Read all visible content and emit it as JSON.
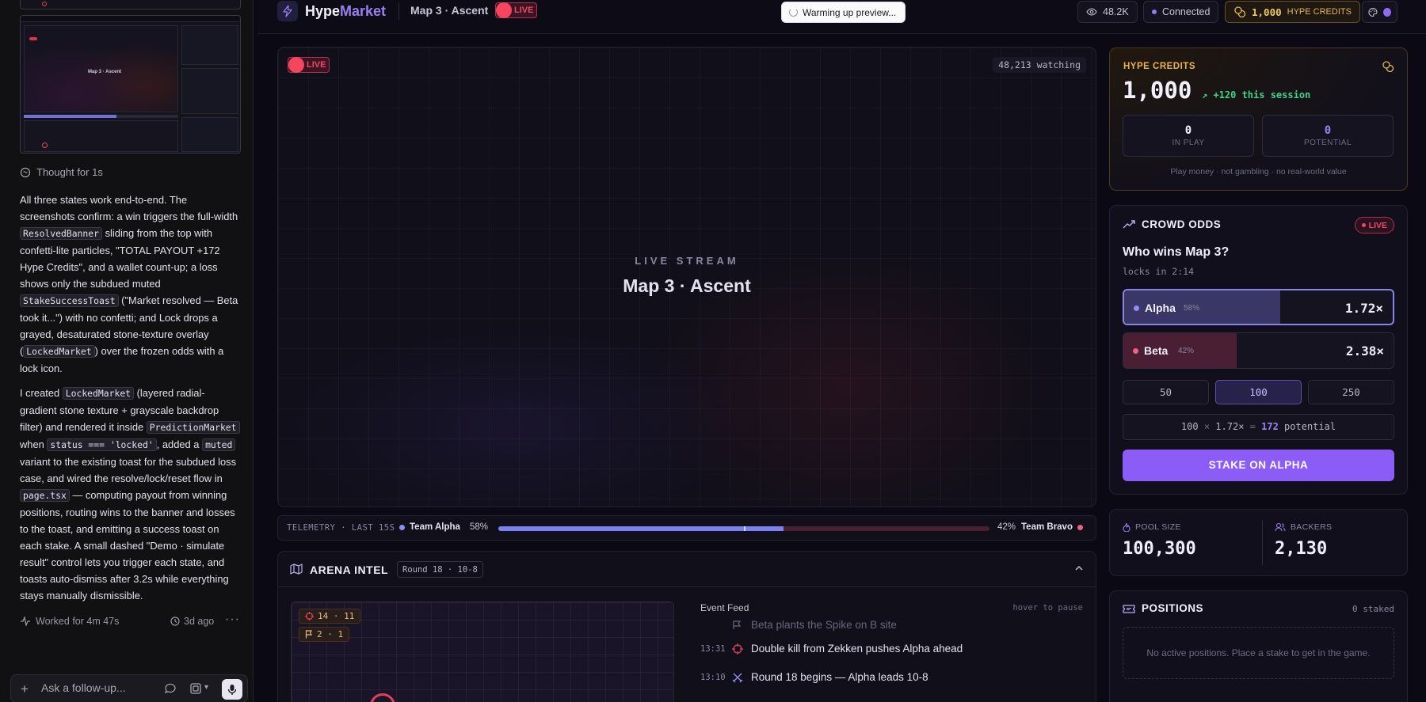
{
  "chat": {
    "thought": "Thought for 1s",
    "thumbnail": {
      "brand": "HypeMarket",
      "stream_title": "Map 3 · Ascent"
    },
    "paragraph1": {
      "t1": "All three states work end-to-end. The screenshots confirm: a win triggers the full-width ",
      "c1": "ResolvedBanner",
      "t2": " sliding from the top with confetti-lite particles, \"TOTAL PAYOUT +172 Hype Credits\", and a wallet count-up; a loss shows only the subdued muted ",
      "c2": "StakeSuccessToast",
      "t3": " (\"Market resolved — Beta took it...\") with no confetti; and Lock drops a grayed, desaturated stone-texture overlay (",
      "c3": "LockedMarket",
      "t4": ") over the frozen odds with a lock icon."
    },
    "paragraph2": {
      "t1": "I created ",
      "c1": "LockedMarket",
      "t2": " (layered radial-gradient stone texture + grayscale backdrop filter) and rendered it inside ",
      "c2": "PredictionMarket",
      "t3": " when ",
      "c3": "status === 'locked'",
      "t4": ", added a ",
      "c4": "muted",
      "t5": " variant to the existing toast for the subdued loss case, and wired the resolve/lock/reset flow in ",
      "c5": "page.tsx",
      "t6": " — computing payout from winning positions, routing wins to the banner and losses to the toast, and emitting a success toast on each stake. A small dashed \"Demo · simulate result\" control lets you trigger each state, and toasts auto-dismiss after 3.2s while everything stays manually dismissible."
    },
    "worked": "Worked for 4m 47s",
    "ago": "3d ago",
    "followup_placeholder": "Ask a follow-up..."
  },
  "nav": {
    "brand_a": "Hype",
    "brand_b": "Market",
    "map": "Map 3 · Ascent",
    "live": "LIVE",
    "toast": "Warming up preview...",
    "viewers": "48.2K",
    "connection": "Connected",
    "credits_value": "1,000",
    "credits_label": "HYPE CREDITS"
  },
  "stream": {
    "live": "LIVE",
    "watching": "48,213 watching",
    "kicker": "LIVE STREAM",
    "title": "Map 3 · Ascent"
  },
  "telemetry": {
    "label": "TELEMETRY · LAST 15S",
    "team_a": "Team Alpha",
    "team_a_pct": "58%",
    "team_b_pct": "42%",
    "team_b": "Team Bravo",
    "alpha_share": 0.58
  },
  "arena": {
    "title": "ARENA INTEL",
    "round": "Round 18 · 10-8",
    "kills": "14 · 11",
    "plants": "2 · 1",
    "feed_title": "Event Feed",
    "feed_hint": "hover to pause",
    "feed": [
      {
        "ts": "",
        "text": "Beta plants the Spike on B site"
      },
      {
        "ts": "13:31",
        "text": "Double kill from Zekken pushes Alpha ahead"
      },
      {
        "ts": "13:10",
        "text": "Round 18 begins — Alpha leads 10-8"
      }
    ]
  },
  "credits_card": {
    "label": "HYPE CREDITS",
    "value": "1,000",
    "delta": "+120 this session",
    "in_play_value": "0",
    "in_play_label": "IN PLAY",
    "potential_value": "0",
    "potential_label": "POTENTIAL",
    "footer": "Play money · not gambling · no real-world value"
  },
  "odds": {
    "title": "CROWD ODDS",
    "live": "LIVE",
    "question": "Who wins Map 3?",
    "locks": "locks in 2:14",
    "teams": [
      {
        "name": "Alpha",
        "pct": "58%",
        "share": 0.58,
        "odds": "1.72×"
      },
      {
        "name": "Beta",
        "pct": "42%",
        "share": 0.42,
        "odds": "2.38×"
      }
    ],
    "amounts": [
      "50",
      "100",
      "250"
    ],
    "selected_amount": "100",
    "calc_stake": "100",
    "calc_x": "×",
    "calc_mult": "1.72×",
    "calc_eq": "=",
    "calc_result": "172",
    "calc_suffix": "potential",
    "stake_button": "STAKE ON ALPHA"
  },
  "pool": {
    "pool_label": "POOL SIZE",
    "pool_value": "100,300",
    "backers_label": "BACKERS",
    "backers_value": "2,130"
  },
  "positions": {
    "title": "POSITIONS",
    "count": "0 staked",
    "empty": "No active positions. Place a stake to get in the game."
  },
  "colors": {
    "accent": "#8b5cf6",
    "live": "#f4465f",
    "alpha": "#8a8ff0",
    "beta": "#f0608a",
    "credits": "#e8b548",
    "positive": "#3fd28a"
  }
}
